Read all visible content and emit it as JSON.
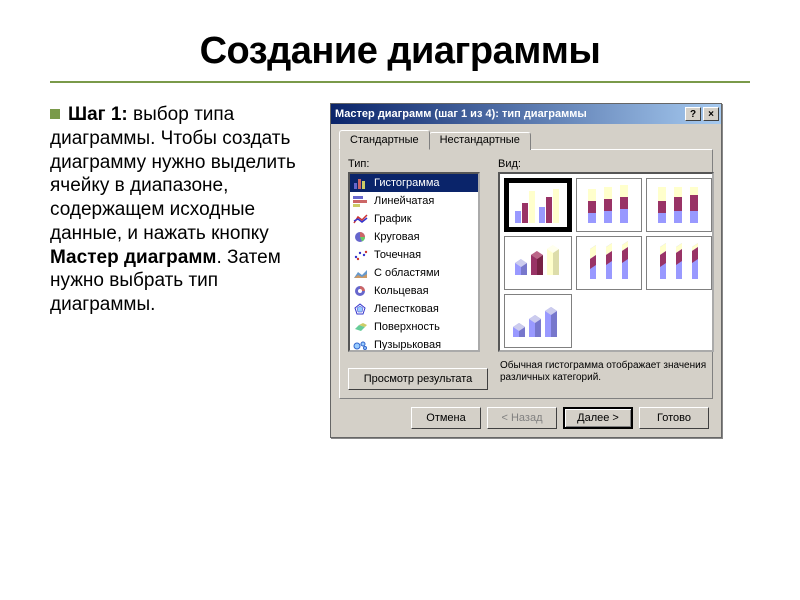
{
  "slide": {
    "title": "Создание диаграммы",
    "step_lead": "Шаг 1:",
    "step_rest": " выбор типа диаграммы. Чтобы создать диаграмму нужно выделить ячейку в диапазоне, содержащем исходные данные, и нажать кнопку ",
    "step_bold2": "Мастер диаграмм",
    "step_tail": ". Затем нужно выбрать тип диаграммы."
  },
  "dialog": {
    "title": "Мастер диаграмм (шаг 1 из 4): тип диаграммы",
    "help_btn": "?",
    "close_btn": "×",
    "tabs": {
      "standard": "Стандартные",
      "nonstandard": "Нестандартные"
    },
    "labels": {
      "type": "Тип:",
      "view": "Вид:"
    },
    "types": [
      {
        "icon": "histogram",
        "label": "Гистограмма",
        "selected": true
      },
      {
        "icon": "bar",
        "label": "Линейчатая"
      },
      {
        "icon": "line",
        "label": "График"
      },
      {
        "icon": "pie",
        "label": "Круговая"
      },
      {
        "icon": "scatter",
        "label": "Точечная"
      },
      {
        "icon": "area",
        "label": "С областями"
      },
      {
        "icon": "doughnut",
        "label": "Кольцевая"
      },
      {
        "icon": "radar",
        "label": "Лепестковая"
      },
      {
        "icon": "surface",
        "label": "Поверхность"
      },
      {
        "icon": "bubble",
        "label": "Пузырьковая"
      }
    ],
    "description": "Обычная гистограмма отображает значения различных категорий.",
    "preview_btn": "Просмотр результата",
    "buttons": {
      "cancel": "Отмена",
      "back": "< Назад",
      "next": "Далее >",
      "finish": "Готово"
    }
  }
}
